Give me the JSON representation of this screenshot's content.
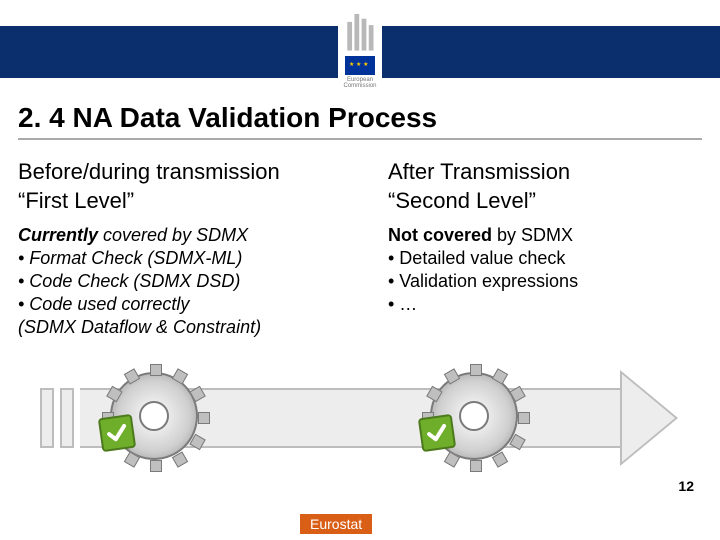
{
  "logo": {
    "org_top": "European",
    "org_bot": "Commission"
  },
  "title": "2. 4 NA Data Validation Process",
  "left": {
    "heading_l1": "Before/during transmission",
    "heading_l2": "“First Level”",
    "intro_strong": "Currently",
    "intro_rest": " covered by SDMX",
    "b1": "• Format Check (SDMX-ML)",
    "b2": "• Code Check (SDMX DSD)",
    "b3": "• Code used correctly",
    "b4": "(SDMX Dataflow & Constraint)"
  },
  "right": {
    "heading_l1": "After Transmission",
    "heading_l2": "“Second Level”",
    "intro_strong": "Not covered",
    "intro_rest": " by SDMX",
    "b1": "• Detailed value check",
    "b2": "• Validation expressions",
    "b3": "• …"
  },
  "page_number": "12",
  "footer_brand": "Eurostat"
}
